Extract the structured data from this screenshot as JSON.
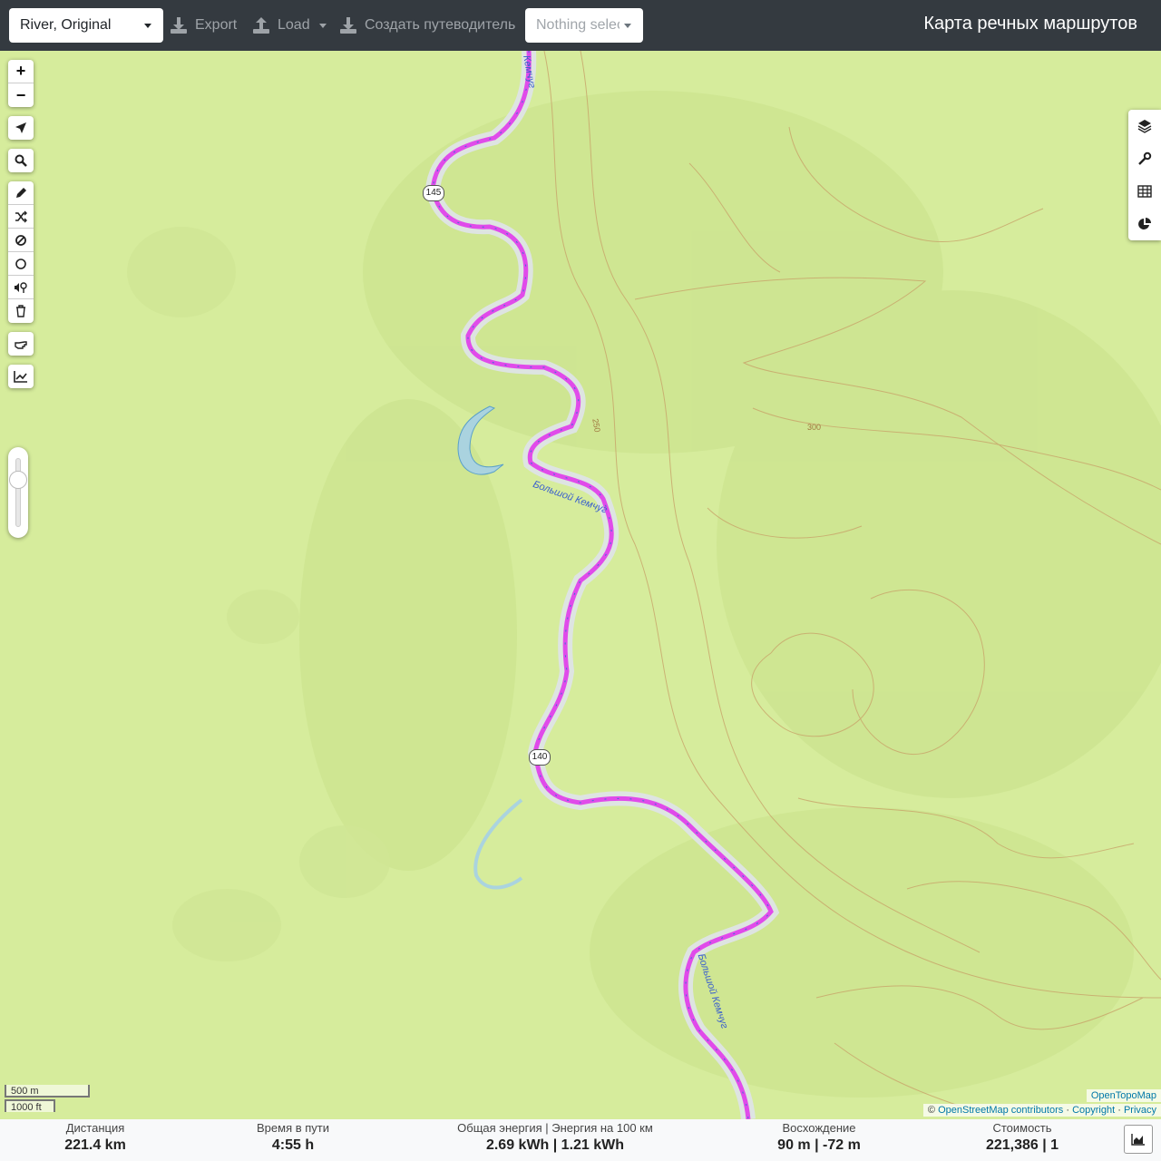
{
  "header": {
    "profile_value": "River, Original",
    "export_label": "Export",
    "load_label": "Load",
    "guide_label": "Создать путеводитель",
    "selection_placeholder": "Nothing selected",
    "brand": "Карта речных маршрутов"
  },
  "map": {
    "river_labels": [
      "Большой Кемчуг",
      "Кемчуг",
      "Большой Кемчуг"
    ],
    "km_markers": [
      "145",
      "140"
    ],
    "contour_labels": [
      "250",
      "300"
    ],
    "left_controls": [
      "zoom-in",
      "zoom-out",
      "locate",
      "search",
      "draw",
      "shuffle",
      "no-go",
      "circle",
      "poi",
      "delete",
      "hand",
      "elevation-chart"
    ],
    "right_controls": [
      "layers",
      "wrench",
      "table",
      "pie-chart"
    ],
    "scale_metric": "500 m",
    "scale_imperial": "1000 ft",
    "attribution": {
      "layer": "OpenTopoMap",
      "prefix": "©",
      "osm": "OpenStreetMap contributors",
      "sep1": "·",
      "copyright": "Copyright",
      "sep2": "·",
      "privacy": "Privacy"
    }
  },
  "stats": {
    "distance": {
      "label": "Дистанция",
      "value": "221.4 km"
    },
    "time": {
      "label": "Время в пути",
      "value": "4:55 h"
    },
    "energy": {
      "label": "Общая энергия | Энергия на 100 км",
      "value": "2.69 kWh | 1.21 kWh"
    },
    "ascent": {
      "label": "Восхождение",
      "value": "90 m | -72 m"
    },
    "cost": {
      "label": "Стоимость",
      "value": "221,386 | 1"
    }
  },
  "colors": {
    "route": "#e04bea",
    "river": "#aad3df",
    "map_bg": "#d6ec9c",
    "contour": "#c8a46a",
    "topbar": "#343a40"
  }
}
